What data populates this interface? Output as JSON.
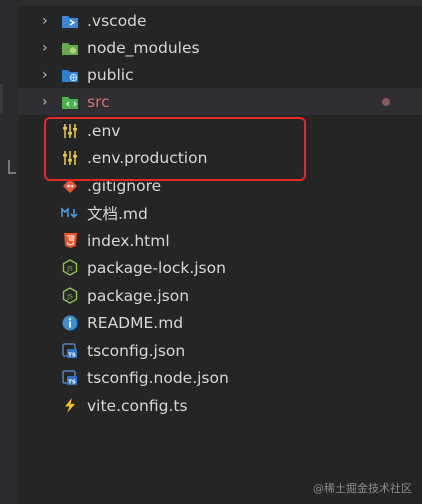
{
  "explorer": {
    "items": [
      {
        "label": ".vscode",
        "type": "folder",
        "icon": "vscode-folder-icon",
        "expanded": false
      },
      {
        "label": "node_modules",
        "type": "folder",
        "icon": "node-modules-folder-icon",
        "expanded": false
      },
      {
        "label": "public",
        "type": "folder",
        "icon": "public-folder-icon",
        "expanded": false
      },
      {
        "label": "src",
        "type": "folder",
        "icon": "src-folder-icon",
        "expanded": false,
        "modified": true,
        "label_color": "#e06c6c"
      },
      {
        "label": ".env",
        "type": "file",
        "icon": "env-settings-icon"
      },
      {
        "label": ".env.production",
        "type": "file",
        "icon": "env-settings-icon"
      },
      {
        "label": ".gitignore",
        "type": "file",
        "icon": "git-icon"
      },
      {
        "label": "文档.md",
        "type": "file",
        "icon": "markdown-icon"
      },
      {
        "label": "index.html",
        "type": "file",
        "icon": "html5-icon"
      },
      {
        "label": "package-lock.json",
        "type": "file",
        "icon": "nodejs-icon"
      },
      {
        "label": "package.json",
        "type": "file",
        "icon": "nodejs-icon"
      },
      {
        "label": "README.md",
        "type": "file",
        "icon": "info-icon"
      },
      {
        "label": "tsconfig.json",
        "type": "file",
        "icon": "ts-config-icon"
      },
      {
        "label": "tsconfig.node.json",
        "type": "file",
        "icon": "ts-config-icon"
      },
      {
        "label": "vite.config.ts",
        "type": "file",
        "icon": "vite-icon"
      }
    ]
  },
  "watermark": "@稀土掘金技术社区",
  "colors": {
    "highlight_box": "#e3282c",
    "panel_bg": "#252526"
  }
}
